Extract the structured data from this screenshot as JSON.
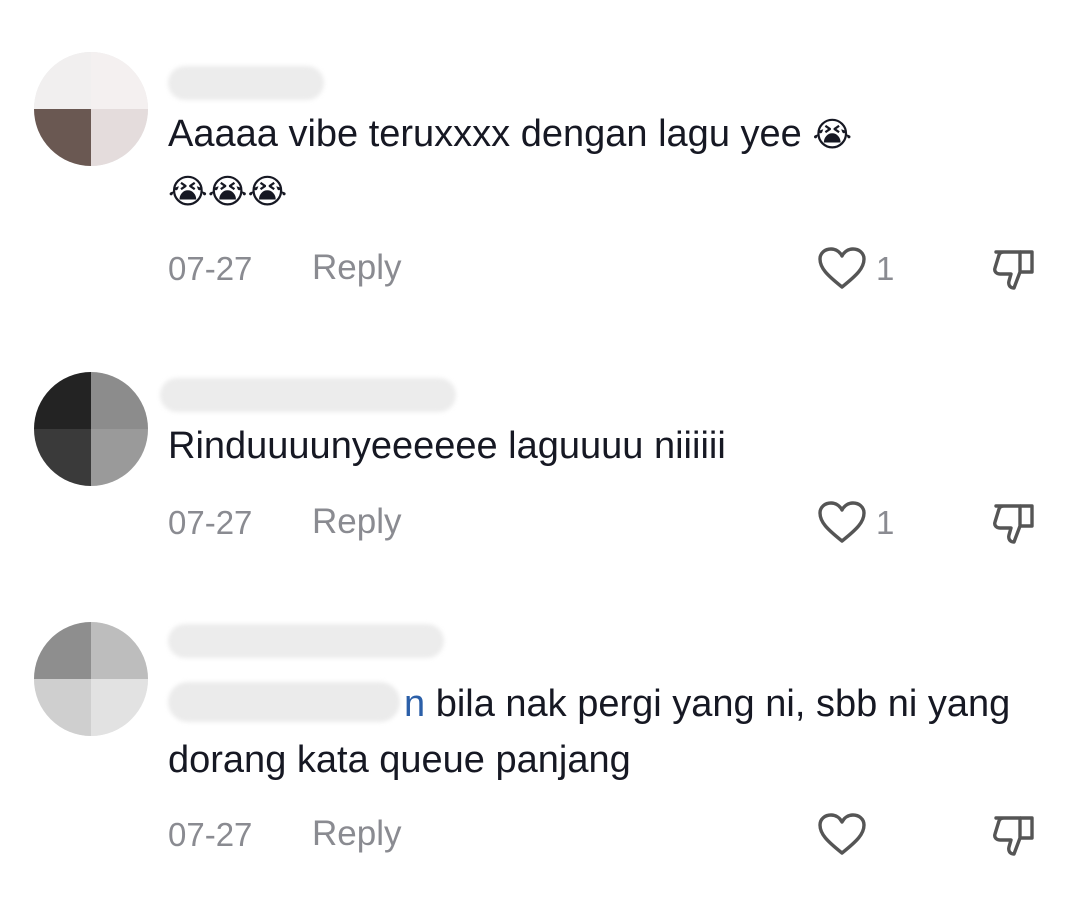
{
  "comments": [
    {
      "text": "Aaaaa vibe teruxxxx dengan lagu yee",
      "emojis_inline": "😭",
      "emojis_line2": "😭😭😭",
      "date": "07-27",
      "reply_label": "Reply",
      "likes": "1"
    },
    {
      "text": "Rinduuuunyeeeeee laguuuu niiiiii",
      "date": "07-27",
      "reply_label": "Reply",
      "likes": "1"
    },
    {
      "mention_suffix": "n",
      "text": " bila nak pergi yang ni, sbb ni yang dorang kata queue panjang",
      "date": "07-27",
      "reply_label": "Reply",
      "likes": ""
    }
  ],
  "colors": {
    "text": "#161823",
    "meta": "#8a8b91",
    "mention": "#2b5fa8"
  },
  "icons": [
    "heart-outline-icon",
    "thumbs-down-icon"
  ]
}
